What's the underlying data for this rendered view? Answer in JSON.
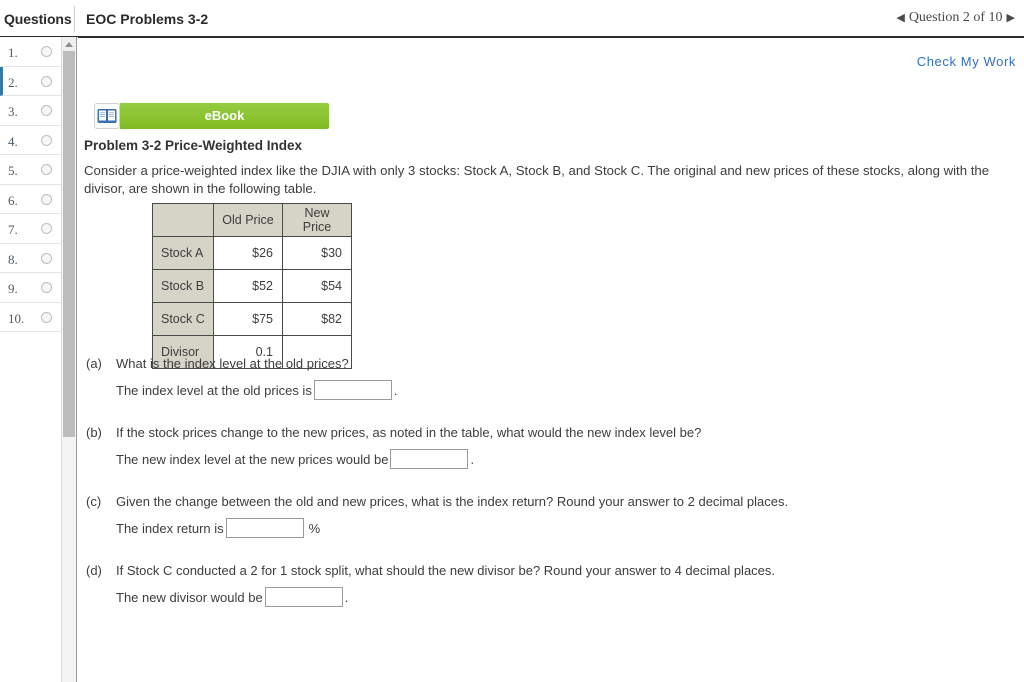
{
  "topbar": {
    "questions_label": "Questions",
    "title": "EOC Problems 3-2",
    "pager_prev": "◀",
    "pager_text": "Question 2 of 10",
    "pager_next": "▶"
  },
  "question_list": {
    "items": [
      {
        "number": "1."
      },
      {
        "number": "2."
      },
      {
        "number": "3."
      },
      {
        "number": "4."
      },
      {
        "number": "5."
      },
      {
        "number": "6."
      },
      {
        "number": "7."
      },
      {
        "number": "8."
      },
      {
        "number": "9."
      },
      {
        "number": "10."
      }
    ],
    "active_index": 1
  },
  "content": {
    "check_my_work": "Check My Work",
    "ebook_label": "eBook",
    "problem_title": "Problem 3-2 Price-Weighted Index",
    "problem_body": "Consider a price-weighted index like the DJIA with only 3 stocks: Stock A, Stock B, and Stock C. The original and new prices of these stocks, along with the divisor, are shown in the following table."
  },
  "table": {
    "corner": "",
    "columns": [
      "Old Price",
      "New Price"
    ],
    "rows": [
      {
        "label": "Stock A",
        "old": "$26",
        "new": "$30"
      },
      {
        "label": "Stock B",
        "old": "$52",
        "new": "$54"
      },
      {
        "label": "Stock C",
        "old": "$75",
        "new": "$82"
      },
      {
        "label": "Divisor",
        "old": "0.1",
        "new": ""
      }
    ]
  },
  "questions": [
    {
      "letter": "(a)",
      "prompt": "What is the index level at the old prices?",
      "answer_text": "The index level at the old prices is",
      "input_value": "",
      "suffix": "."
    },
    {
      "letter": "(b)",
      "prompt": "If the stock prices change to the new prices, as noted in the table, what would the new index level be?",
      "answer_text": "The new index level at the new prices would be",
      "input_value": "",
      "suffix": "."
    },
    {
      "letter": "(c)",
      "prompt": "Given the change between the old and new prices, what is the index return? Round your answer to 2 decimal places.",
      "answer_text": "The index return is",
      "input_value": "",
      "suffix": "%"
    },
    {
      "letter": "(d)",
      "prompt": "If Stock C conducted a 2 for 1 stock split, what should the new divisor be? Round your answer to 4 decimal places.",
      "answer_text": "The new divisor would be",
      "input_value": "",
      "suffix": "."
    }
  ],
  "colors": {
    "accent_blue": "#2f6fc4",
    "active_marker": "#3579a8",
    "ebook_green": "#85c226",
    "table_header": "#d6d3c7"
  }
}
